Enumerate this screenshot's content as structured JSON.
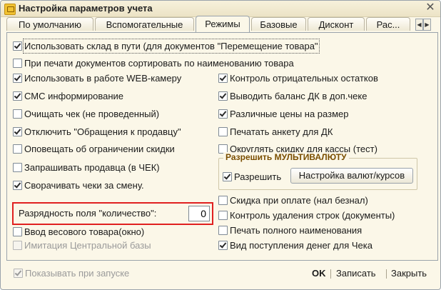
{
  "window": {
    "title": "Настройка параметров учета",
    "close_glyph": "✕"
  },
  "tabs": [
    {
      "label": "По умолчанию",
      "active": false
    },
    {
      "label": "Вспомогательные",
      "active": false
    },
    {
      "label": "Режимы",
      "active": true
    },
    {
      "label": "Базовые",
      "active": false
    },
    {
      "label": "Дисконт",
      "active": false
    },
    {
      "label": "Рас...",
      "active": false
    }
  ],
  "tab_scroll": {
    "left": "◀",
    "right": "▶"
  },
  "left_options": [
    {
      "label": "Использовать склад в пути (для документов \"Перемещение товара\"",
      "checked": true
    },
    {
      "label": "При печати документов сортировать по наименованию товара",
      "checked": false
    },
    {
      "label": "Использовать в работе WEB-камеру",
      "checked": true
    },
    {
      "label": "СМС информирование",
      "checked": true
    },
    {
      "label": "Очищать чек (не проведенный)",
      "checked": false
    },
    {
      "label": "Отключить \"Обращения к продавцу\"",
      "checked": true
    },
    {
      "label": "Оповещать об ограничении скидки",
      "checked": false
    },
    {
      "label": "Запрашивать продавца (в ЧЕК)",
      "checked": false
    },
    {
      "label": "Сворачивать чеки за смену.",
      "checked": true
    }
  ],
  "right_options": [
    {
      "label": "Контроль отрицательных остатков",
      "checked": true
    },
    {
      "label": "Выводить баланс ДК в доп.чеке",
      "checked": true
    },
    {
      "label": "Различные цены на размер",
      "checked": true
    },
    {
      "label": "Печатать анкету для ДК",
      "checked": false
    },
    {
      "label": "Округлять скидку для кассы (тест)",
      "checked": false
    }
  ],
  "multicurrency": {
    "title": "Разрешить МУЛЬТИВАЛЮТУ",
    "allow_label": "Разрешить",
    "allow_checked": true,
    "settings_button": "Настройка валют/курсов"
  },
  "right_options_2": [
    {
      "label": "Скидка при оплате (нал безнал)",
      "checked": false
    },
    {
      "label": "Контроль удаления строк (документы)",
      "checked": false
    },
    {
      "label": "Печать полного наименования",
      "checked": false
    },
    {
      "label": "Вид поступления денег для Чека",
      "checked": true
    }
  ],
  "quantity_digits": {
    "label": "Разрядность поля \"количество\":",
    "value": "0"
  },
  "left_options_2": [
    {
      "label": "Ввод весового товара(окно)",
      "checked": false,
      "disabled": false
    },
    {
      "label": "Имитация Центральной базы",
      "checked": false,
      "disabled": true
    }
  ],
  "footer": {
    "show_on_start_label": "Показывать при запуске",
    "show_on_start_checked": true,
    "ok": "OK",
    "save": "Записать",
    "close": "Закрыть"
  }
}
